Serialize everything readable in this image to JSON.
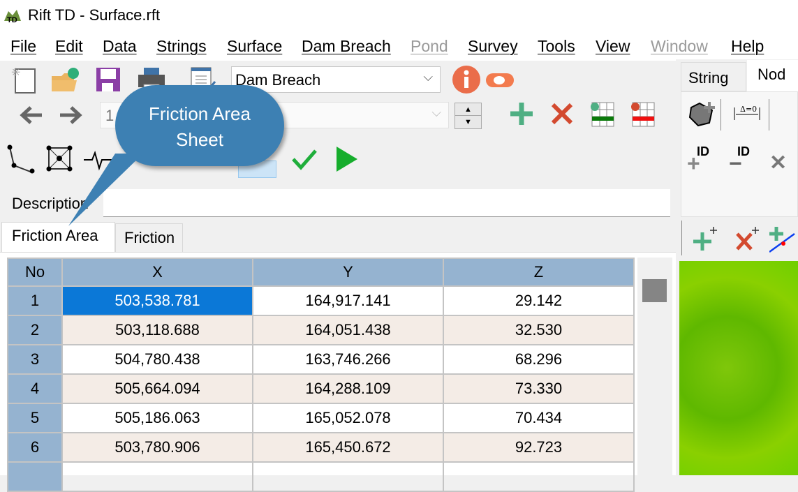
{
  "window": {
    "title": "Rift TD - Surface.rft"
  },
  "menu": [
    {
      "label": "File",
      "enabled": true
    },
    {
      "label": "Edit",
      "enabled": true
    },
    {
      "label": "Data",
      "enabled": true
    },
    {
      "label": "Strings",
      "enabled": true
    },
    {
      "label": "Surface",
      "enabled": true
    },
    {
      "label": "Dam Breach",
      "enabled": true
    },
    {
      "label": "Pond",
      "enabled": false
    },
    {
      "label": "Survey",
      "enabled": true
    },
    {
      "label": "Tools",
      "enabled": true
    },
    {
      "label": "View",
      "enabled": true
    },
    {
      "label": "Window",
      "enabled": false
    },
    {
      "label": "Help",
      "enabled": true
    }
  ],
  "toolbar": {
    "mode_select": "Dam Breach",
    "record_select": "1"
  },
  "description": {
    "label": "Description",
    "value": ""
  },
  "tabs": [
    {
      "label": "Friction Area",
      "active": true
    },
    {
      "label": "Friction",
      "active": false
    }
  ],
  "table": {
    "columns": [
      "No",
      "X",
      "Y",
      "Z"
    ],
    "rows": [
      [
        "1",
        "503,538.781",
        "164,917.141",
        "29.142"
      ],
      [
        "2",
        "503,118.688",
        "164,051.438",
        "32.530"
      ],
      [
        "3",
        "504,780.438",
        "163,746.266",
        "68.296"
      ],
      [
        "4",
        "505,664.094",
        "164,288.109",
        "73.330"
      ],
      [
        "5",
        "505,186.063",
        "165,052.078",
        "70.434"
      ],
      [
        "6",
        "503,780.906",
        "165,450.672",
        "92.723"
      ]
    ]
  },
  "right_panel": {
    "tabs": [
      "String",
      "Nod"
    ],
    "id_label": "ID"
  },
  "callout": {
    "line1": "Friction Area",
    "line2": "Sheet"
  },
  "colors": {
    "header": "#95b3d0",
    "selected": "#0b78d7",
    "alt_row": "#f4ece6",
    "callout": "#3d80b3"
  }
}
